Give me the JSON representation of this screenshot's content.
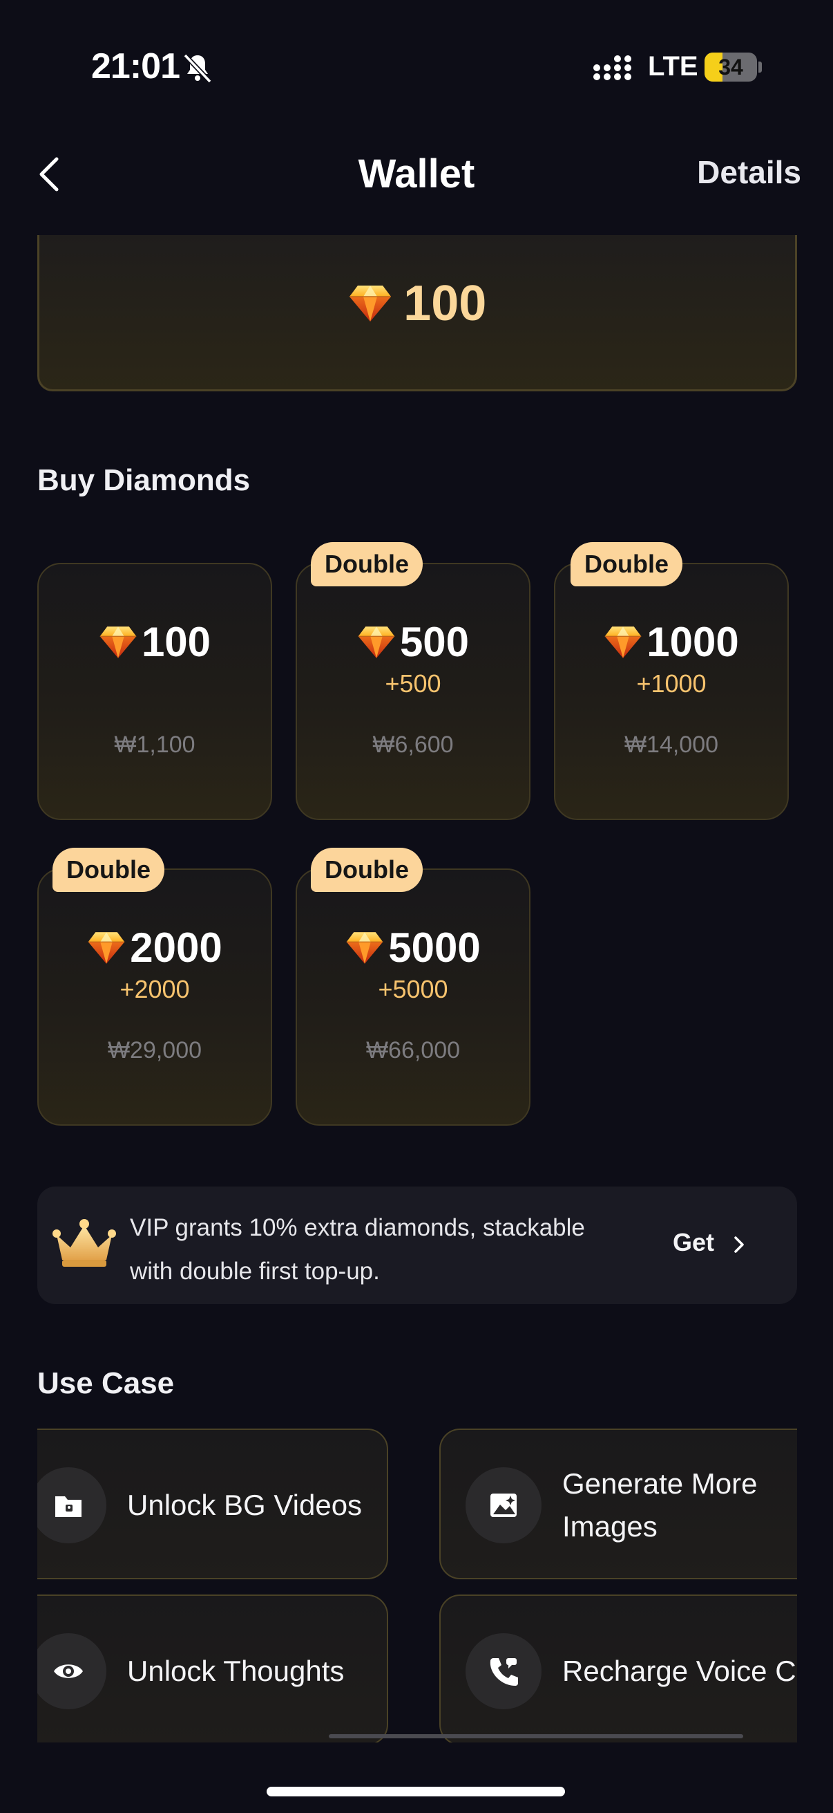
{
  "status_bar": {
    "time": "21:01",
    "network": "LTE",
    "battery": "34",
    "battery_level": 0.34
  },
  "header": {
    "title": "Wallet",
    "details_label": "Details"
  },
  "balance": {
    "value": "100"
  },
  "buy_section": {
    "title": "Buy Diamonds",
    "packages": [
      {
        "amount": "100",
        "bonus": "",
        "price": "₩1,100",
        "badge": ""
      },
      {
        "amount": "500",
        "bonus": "+500",
        "price": "₩6,600",
        "badge": "Double"
      },
      {
        "amount": "1000",
        "bonus": "+1000",
        "price": "₩14,000",
        "badge": "Double"
      },
      {
        "amount": "2000",
        "bonus": "+2000",
        "price": "₩29,000",
        "badge": "Double"
      },
      {
        "amount": "5000",
        "bonus": "+5000",
        "price": "₩66,000",
        "badge": "Double"
      }
    ]
  },
  "vip_banner": {
    "line1": "VIP grants 10% extra diamonds, stackable",
    "line2": "with double first top-up.",
    "get_label": "Get"
  },
  "use_case": {
    "title": "Use Case",
    "items": [
      {
        "label": "Unlock BG Videos",
        "icon": "lock-folder-icon"
      },
      {
        "label": "Generate More",
        "label2": "Images",
        "icon": "image-sparkle-icon"
      },
      {
        "label": "Unlock Thoughts",
        "icon": "eye-icon"
      },
      {
        "label": "Recharge Voice C",
        "icon": "phone-icon"
      }
    ]
  },
  "colors": {
    "background": "#0d0d17",
    "accent": "#fcd59b",
    "bonus": "#f7c36e",
    "price": "#7d7c80"
  }
}
